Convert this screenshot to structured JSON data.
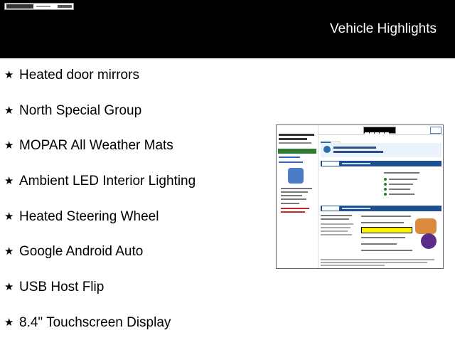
{
  "header": {
    "title": "Vehicle Highlights"
  },
  "features": [
    {
      "label": "Heated door mirrors"
    },
    {
      "label": "North Special Group"
    },
    {
      "label": "MOPAR All Weather Mats"
    },
    {
      "label": "Ambient LED Interior Lighting"
    },
    {
      "label": "Heated Steering Wheel"
    },
    {
      "label": "Google Android Auto"
    },
    {
      "label": "USB Host Flip"
    },
    {
      "label": "8.4\" Touchscreen Display"
    }
  ],
  "icons": {
    "bullet": "star-icon",
    "dealer_logo": "dealer-logo-icon",
    "report": "carfax-report-thumbnail"
  },
  "colors": {
    "header_bg": "#000000",
    "header_text": "#ffffff",
    "carfax_blue": "#1e4f93",
    "highlight": "#fff200"
  }
}
